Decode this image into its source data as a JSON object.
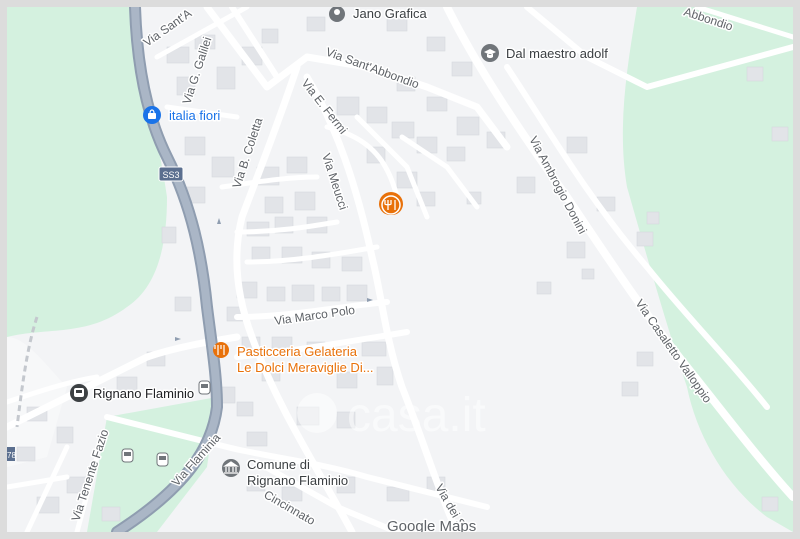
{
  "map": {
    "streets": {
      "via_santabbondio_top": "Via Sant'A",
      "via_santabbondio": "Via Sant'Abbondio",
      "via_galilei": "Via G. Galilei",
      "via_fermi": "Via E. Fermi",
      "via_coletta": "Via B. Coletta",
      "via_meucci": "Via Meucci",
      "via_marco_polo": "Via Marco Polo",
      "via_ambrogio_donini": "Via Ambrogio Donini",
      "via_casaletto": "Via Casaletto Valloppio",
      "via_abbondio_topright": "Abbondio",
      "via_flaminia": "Via Flaminia",
      "via_tenente_fazio": "Via Tenente Fazio",
      "via_cincinnato": "Cincinnato",
      "via_dei_s": "Via dei S",
      "road_shield": "SS3",
      "edge_label": "78"
    },
    "pois": {
      "jano_grafica": "Jano Grafica",
      "dal_maestro": "Dal maestro adolf",
      "italia_fiori": "italia fiori",
      "pasticceria_line1": "Pasticceria Gelateria",
      "pasticceria_line2": "Le Dolci Meraviglie Di...",
      "comune_line1": "Comune di",
      "comune_line2": "Rignano Flaminio",
      "station": "Rignano Flaminio"
    },
    "watermark": "casa.it",
    "attribution": "Google Maps",
    "colors": {
      "land": "#f3f4f6",
      "park": "#d4f1df",
      "road_major": "#8f9db0",
      "road_minor": "#ffffff",
      "building": "#e2e4e8",
      "poi_blue": "#1a73e8",
      "poi_orange": "#e8710a",
      "poi_gray": "#70757a"
    }
  }
}
